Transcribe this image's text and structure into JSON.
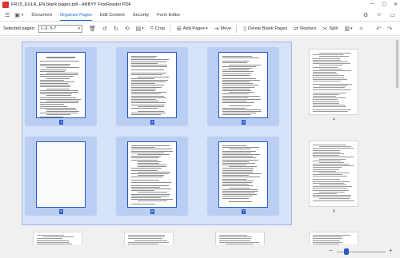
{
  "window": {
    "title": "FR15_EULA_EN blank pages.pdf - ABBYY FineReader PDF",
    "minimize": "—",
    "maximize": "☐",
    "close": "✕"
  },
  "menu": {
    "tabs": [
      "Document",
      "Organize Pages",
      "Edit Content",
      "Security",
      "Form Editor"
    ]
  },
  "toolbar": {
    "selected_label": "Selected pages:",
    "selected_value": "1-3, 5-7",
    "crop": "Crop",
    "add_pages": "Add Pages",
    "move": "Move",
    "delete_blank": "Delete Blank Pages",
    "replace": "Replace",
    "split": "Split"
  },
  "pages": {
    "selected": [
      {
        "num": "1",
        "blank": false
      },
      {
        "num": "2",
        "blank": false
      },
      {
        "num": "3",
        "blank": false
      },
      {
        "num": "5",
        "blank": true
      },
      {
        "num": "6",
        "blank": false
      },
      {
        "num": "7",
        "blank": false
      }
    ],
    "side": [
      {
        "num": "4"
      },
      {
        "num": "8"
      }
    ]
  },
  "zoom": {
    "minus": "−",
    "plus": "+",
    "level": 0.2
  },
  "colors": {
    "accent": "#2a57c9",
    "selection_bg": "#d6e2f7",
    "cell_bg": "#b9cef2",
    "active_tab": "#2266c7",
    "app_icon": "#d9342b"
  }
}
